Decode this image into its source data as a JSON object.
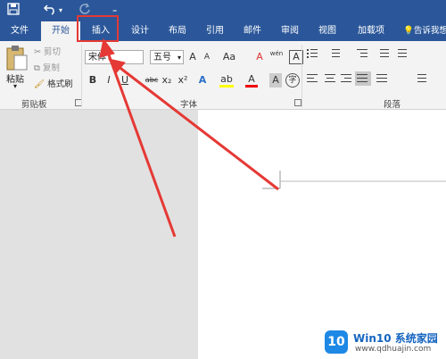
{
  "quick_access": {
    "save_icon": "save-icon",
    "undo_icon": "undo-icon",
    "redo_icon": "redo-icon",
    "customize": "₌"
  },
  "tabs": [
    {
      "label": "文件"
    },
    {
      "label": "开始"
    },
    {
      "label": "插入"
    },
    {
      "label": "设计"
    },
    {
      "label": "布局"
    },
    {
      "label": "引用"
    },
    {
      "label": "邮件"
    },
    {
      "label": "审阅"
    },
    {
      "label": "视图"
    },
    {
      "label": "加载项"
    }
  ],
  "tell_me": "告诉我想",
  "clipboard": {
    "paste": "粘贴",
    "cut": "剪切",
    "copy": "复制",
    "format_painter": "格式刷",
    "group": "剪贴板"
  },
  "font": {
    "name": "宋体",
    "size": "五号",
    "grow": "A",
    "shrink": "A",
    "case": "Aa",
    "clear": "A",
    "phonetic": "wén",
    "border": "A",
    "bold": "B",
    "italic": "I",
    "underline": "U",
    "strike": "abc",
    "sub": "x₂",
    "sup": "x²",
    "effects": "A",
    "highlight": "ab",
    "color": "A",
    "shade": "A",
    "enclose": "字",
    "group": "字体"
  },
  "paragraph": {
    "group": "段落"
  },
  "watermark": {
    "brand": "Win10 系统家园",
    "url": "www.qdhuajin.com",
    "logo": "10"
  },
  "colors": {
    "accent": "#2b579a",
    "annotation": "#e53935"
  }
}
